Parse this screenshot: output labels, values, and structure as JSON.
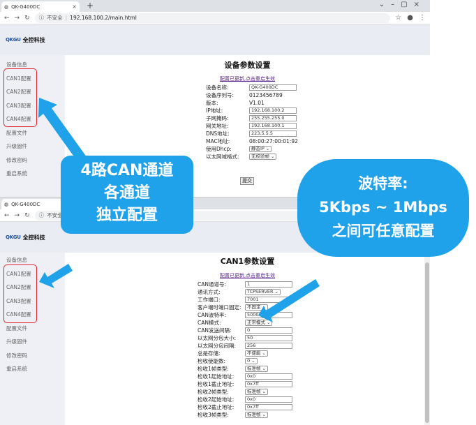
{
  "browser": {
    "tab_title": "QK-G400DC",
    "address_prefix": "不安全",
    "url": "192.168.100.2/main.html"
  },
  "header": {
    "logo_mark": "QKGU",
    "logo_text": "全控科技"
  },
  "sidebar": [
    "设备信息",
    "CAN1配置",
    "CAN2配置",
    "CAN3配置",
    "CAN4配置",
    "配置文件",
    "升级固件",
    "修改密码",
    "重启系统"
  ],
  "device": {
    "title": "设备参数设置",
    "notice": "配置已更新,点击重启生效",
    "rows": [
      {
        "label": "设备名称:",
        "value": "QK-G400DC",
        "kind": "input"
      },
      {
        "label": "设备序列号:",
        "value": "0123456789",
        "kind": "text"
      },
      {
        "label": "版本:",
        "value": "V1.01",
        "kind": "text"
      },
      {
        "label": "IP地址:",
        "value": "192.168.100.2",
        "kind": "input"
      },
      {
        "label": "子网掩码:",
        "value": "255.255.255.0",
        "kind": "input"
      },
      {
        "label": "网关地址:",
        "value": "192.168.100.1",
        "kind": "input"
      },
      {
        "label": "DNS地址:",
        "value": "223.5.5.5",
        "kind": "input"
      },
      {
        "label": "MAC地址:",
        "value": "08:00:27:00:01:92",
        "kind": "text"
      },
      {
        "label": "使用Dhcp:",
        "value": "静态IP",
        "kind": "select"
      },
      {
        "label": "以太网域格式:",
        "value": "无校验帧",
        "kind": "select"
      }
    ],
    "submit": "提交"
  },
  "can1": {
    "tab_title": "QK-G400DC",
    "title": "CAN1参数设置",
    "notice": "配置已更新,点击重启生效",
    "rows": [
      {
        "label": "CAN通道号:",
        "value": "1",
        "kind": "input"
      },
      {
        "label": "通讯方式:",
        "value": "TCPSERVER",
        "kind": "select"
      },
      {
        "label": "工作端口:",
        "value": "7001",
        "kind": "input"
      },
      {
        "label": "客户端时端口固定:",
        "value": "不固定",
        "kind": "select"
      },
      {
        "label": "CAN波特率:",
        "value": "500000",
        "kind": "input"
      },
      {
        "label": "CAN模式:",
        "value": "正常模式",
        "kind": "select"
      },
      {
        "label": "CAN发送间隔:",
        "value": "0",
        "kind": "input"
      },
      {
        "label": "以太网分包大小:",
        "value": "50",
        "kind": "input"
      },
      {
        "label": "以太网分包间隔:",
        "value": "256",
        "kind": "input"
      },
      {
        "label": "总是存储:",
        "value": "不使能",
        "kind": "select"
      },
      {
        "label": "检收使能数:",
        "value": "0",
        "kind": "select"
      },
      {
        "label": "检收1帧类型:",
        "value": "标准帧",
        "kind": "select"
      },
      {
        "label": "检收1起始地址:",
        "value": "0x0",
        "kind": "input"
      },
      {
        "label": "检收1截止地址:",
        "value": "0x7ff",
        "kind": "input"
      },
      {
        "label": "检收2帧类型:",
        "value": "标准帧",
        "kind": "select"
      },
      {
        "label": "检收2起始地址:",
        "value": "0x0",
        "kind": "input"
      },
      {
        "label": "检收2截止地址:",
        "value": "0x7ff",
        "kind": "input"
      },
      {
        "label": "检收3帧类型:",
        "value": "标准帧",
        "kind": "select"
      }
    ]
  },
  "callouts": {
    "left": [
      "4路CAN通道",
      "各通道",
      "独立配置"
    ],
    "right": [
      "波特率:",
      "5Kbps ~ 1Mbps",
      "之间可任意配置"
    ]
  },
  "colors": {
    "callout": "#1fa2ea",
    "highlight": "#e0242b",
    "link": "#551a8b"
  }
}
